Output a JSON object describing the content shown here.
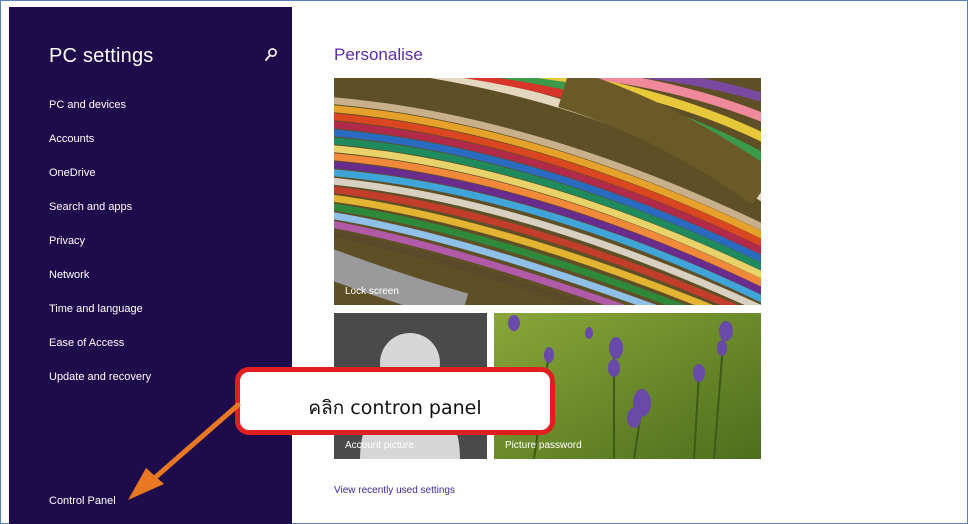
{
  "sidebar": {
    "title": "PC settings",
    "items": [
      {
        "label": "PC and devices"
      },
      {
        "label": "Accounts"
      },
      {
        "label": "OneDrive"
      },
      {
        "label": "Search and apps"
      },
      {
        "label": "Privacy"
      },
      {
        "label": "Network"
      },
      {
        "label": "Time and language"
      },
      {
        "label": "Ease of Access"
      },
      {
        "label": "Update and recovery"
      }
    ],
    "control_panel": "Control Panel",
    "search_icon": "search-icon"
  },
  "main": {
    "title": "Personalise",
    "tiles": {
      "lock_screen": "Lock screen",
      "account_picture": "Account picture",
      "picture_password": "Picture password"
    },
    "recent_link": "View recently used settings"
  },
  "annotation": {
    "text": "คลิก contron panel",
    "border_color": "#e02020",
    "arrow_color": "#e87722"
  },
  "colors": {
    "sidebar_bg": "#1d0b4c",
    "title_accent": "#5b2aa8"
  }
}
